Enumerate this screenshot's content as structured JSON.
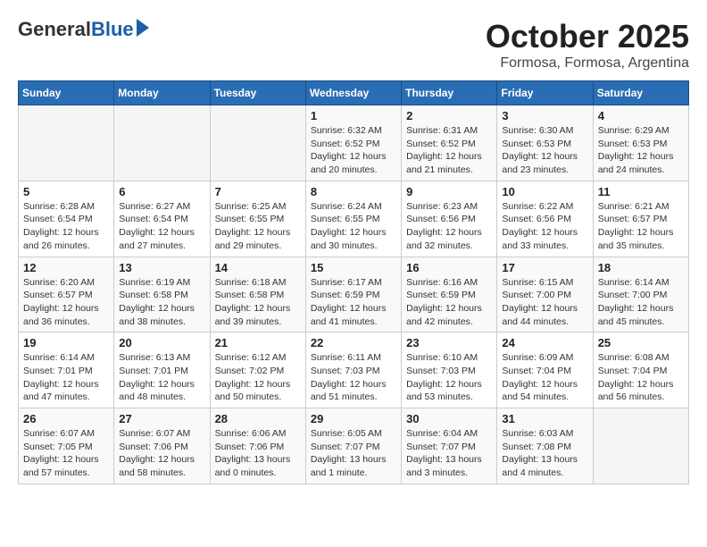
{
  "header": {
    "logo_general": "General",
    "logo_blue": "Blue",
    "title": "October 2025",
    "subtitle": "Formosa, Formosa, Argentina"
  },
  "weekdays": [
    "Sunday",
    "Monday",
    "Tuesday",
    "Wednesday",
    "Thursday",
    "Friday",
    "Saturday"
  ],
  "weeks": [
    [
      {
        "day": "",
        "info": ""
      },
      {
        "day": "",
        "info": ""
      },
      {
        "day": "",
        "info": ""
      },
      {
        "day": "1",
        "info": "Sunrise: 6:32 AM\nSunset: 6:52 PM\nDaylight: 12 hours\nand 20 minutes."
      },
      {
        "day": "2",
        "info": "Sunrise: 6:31 AM\nSunset: 6:52 PM\nDaylight: 12 hours\nand 21 minutes."
      },
      {
        "day": "3",
        "info": "Sunrise: 6:30 AM\nSunset: 6:53 PM\nDaylight: 12 hours\nand 23 minutes."
      },
      {
        "day": "4",
        "info": "Sunrise: 6:29 AM\nSunset: 6:53 PM\nDaylight: 12 hours\nand 24 minutes."
      }
    ],
    [
      {
        "day": "5",
        "info": "Sunrise: 6:28 AM\nSunset: 6:54 PM\nDaylight: 12 hours\nand 26 minutes."
      },
      {
        "day": "6",
        "info": "Sunrise: 6:27 AM\nSunset: 6:54 PM\nDaylight: 12 hours\nand 27 minutes."
      },
      {
        "day": "7",
        "info": "Sunrise: 6:25 AM\nSunset: 6:55 PM\nDaylight: 12 hours\nand 29 minutes."
      },
      {
        "day": "8",
        "info": "Sunrise: 6:24 AM\nSunset: 6:55 PM\nDaylight: 12 hours\nand 30 minutes."
      },
      {
        "day": "9",
        "info": "Sunrise: 6:23 AM\nSunset: 6:56 PM\nDaylight: 12 hours\nand 32 minutes."
      },
      {
        "day": "10",
        "info": "Sunrise: 6:22 AM\nSunset: 6:56 PM\nDaylight: 12 hours\nand 33 minutes."
      },
      {
        "day": "11",
        "info": "Sunrise: 6:21 AM\nSunset: 6:57 PM\nDaylight: 12 hours\nand 35 minutes."
      }
    ],
    [
      {
        "day": "12",
        "info": "Sunrise: 6:20 AM\nSunset: 6:57 PM\nDaylight: 12 hours\nand 36 minutes."
      },
      {
        "day": "13",
        "info": "Sunrise: 6:19 AM\nSunset: 6:58 PM\nDaylight: 12 hours\nand 38 minutes."
      },
      {
        "day": "14",
        "info": "Sunrise: 6:18 AM\nSunset: 6:58 PM\nDaylight: 12 hours\nand 39 minutes."
      },
      {
        "day": "15",
        "info": "Sunrise: 6:17 AM\nSunset: 6:59 PM\nDaylight: 12 hours\nand 41 minutes."
      },
      {
        "day": "16",
        "info": "Sunrise: 6:16 AM\nSunset: 6:59 PM\nDaylight: 12 hours\nand 42 minutes."
      },
      {
        "day": "17",
        "info": "Sunrise: 6:15 AM\nSunset: 7:00 PM\nDaylight: 12 hours\nand 44 minutes."
      },
      {
        "day": "18",
        "info": "Sunrise: 6:14 AM\nSunset: 7:00 PM\nDaylight: 12 hours\nand 45 minutes."
      }
    ],
    [
      {
        "day": "19",
        "info": "Sunrise: 6:14 AM\nSunset: 7:01 PM\nDaylight: 12 hours\nand 47 minutes."
      },
      {
        "day": "20",
        "info": "Sunrise: 6:13 AM\nSunset: 7:01 PM\nDaylight: 12 hours\nand 48 minutes."
      },
      {
        "day": "21",
        "info": "Sunrise: 6:12 AM\nSunset: 7:02 PM\nDaylight: 12 hours\nand 50 minutes."
      },
      {
        "day": "22",
        "info": "Sunrise: 6:11 AM\nSunset: 7:03 PM\nDaylight: 12 hours\nand 51 minutes."
      },
      {
        "day": "23",
        "info": "Sunrise: 6:10 AM\nSunset: 7:03 PM\nDaylight: 12 hours\nand 53 minutes."
      },
      {
        "day": "24",
        "info": "Sunrise: 6:09 AM\nSunset: 7:04 PM\nDaylight: 12 hours\nand 54 minutes."
      },
      {
        "day": "25",
        "info": "Sunrise: 6:08 AM\nSunset: 7:04 PM\nDaylight: 12 hours\nand 56 minutes."
      }
    ],
    [
      {
        "day": "26",
        "info": "Sunrise: 6:07 AM\nSunset: 7:05 PM\nDaylight: 12 hours\nand 57 minutes."
      },
      {
        "day": "27",
        "info": "Sunrise: 6:07 AM\nSunset: 7:06 PM\nDaylight: 12 hours\nand 58 minutes."
      },
      {
        "day": "28",
        "info": "Sunrise: 6:06 AM\nSunset: 7:06 PM\nDaylight: 13 hours\nand 0 minutes."
      },
      {
        "day": "29",
        "info": "Sunrise: 6:05 AM\nSunset: 7:07 PM\nDaylight: 13 hours\nand 1 minute."
      },
      {
        "day": "30",
        "info": "Sunrise: 6:04 AM\nSunset: 7:07 PM\nDaylight: 13 hours\nand 3 minutes."
      },
      {
        "day": "31",
        "info": "Sunrise: 6:03 AM\nSunset: 7:08 PM\nDaylight: 13 hours\nand 4 minutes."
      },
      {
        "day": "",
        "info": ""
      }
    ]
  ]
}
